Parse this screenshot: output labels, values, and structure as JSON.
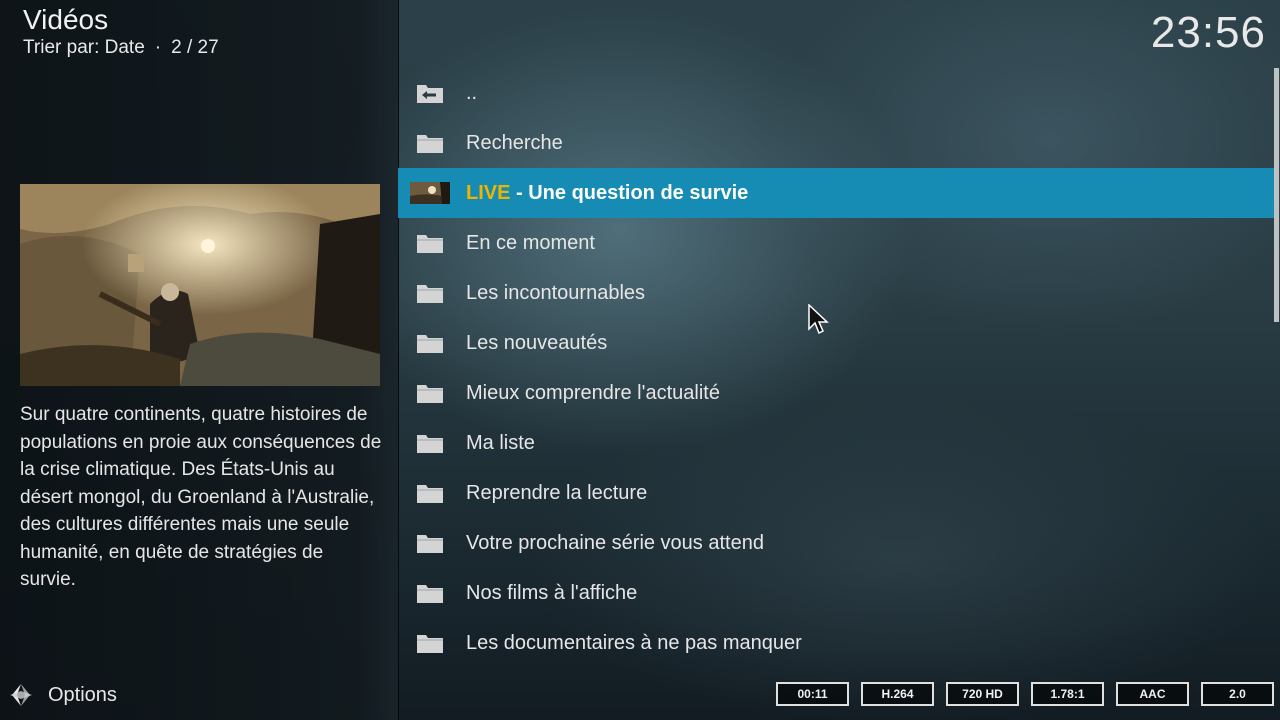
{
  "header": {
    "title": "Vidéos",
    "sort_label": "Trier par: Date",
    "separator": "·",
    "position": "2 / 27"
  },
  "clock": "23:56",
  "preview": {
    "description": "Sur quatre continents, quatre histoires de populations en proie aux conséquences de la crise climatique. Des États-Unis au désert mongol, du Groenland à l'Australie, des cultures différentes mais une seule humanité, en quête de stratégies de survie."
  },
  "footer": {
    "options_label": "Options",
    "badges": [
      "00:11",
      "H.264",
      "720 HD",
      "1.78:1",
      "AAC",
      "2.0"
    ]
  },
  "list": {
    "items": [
      {
        "label": "..",
        "icon": "back-folder-icon"
      },
      {
        "label": "Recherche",
        "icon": "folder-icon"
      },
      {
        "live_prefix": "LIVE",
        "label": " - Une question de survie",
        "icon": "thumbnail",
        "selected": true
      },
      {
        "label": "En ce moment",
        "icon": "folder-icon"
      },
      {
        "label": "Les incontournables",
        "icon": "folder-icon"
      },
      {
        "label": "Les nouveautés",
        "icon": "folder-icon"
      },
      {
        "label": "Mieux comprendre l'actualité",
        "icon": "folder-icon"
      },
      {
        "label": "Ma liste",
        "icon": "folder-icon"
      },
      {
        "label": "Reprendre la lecture",
        "icon": "folder-icon"
      },
      {
        "label": "Votre prochaine série vous attend",
        "icon": "folder-icon"
      },
      {
        "label": "Nos films à l'affiche",
        "icon": "folder-icon"
      },
      {
        "label": "Les documentaires à ne pas manquer",
        "icon": "folder-icon"
      }
    ]
  },
  "colors": {
    "selection": "#168bb3",
    "live": "#f0b400"
  }
}
